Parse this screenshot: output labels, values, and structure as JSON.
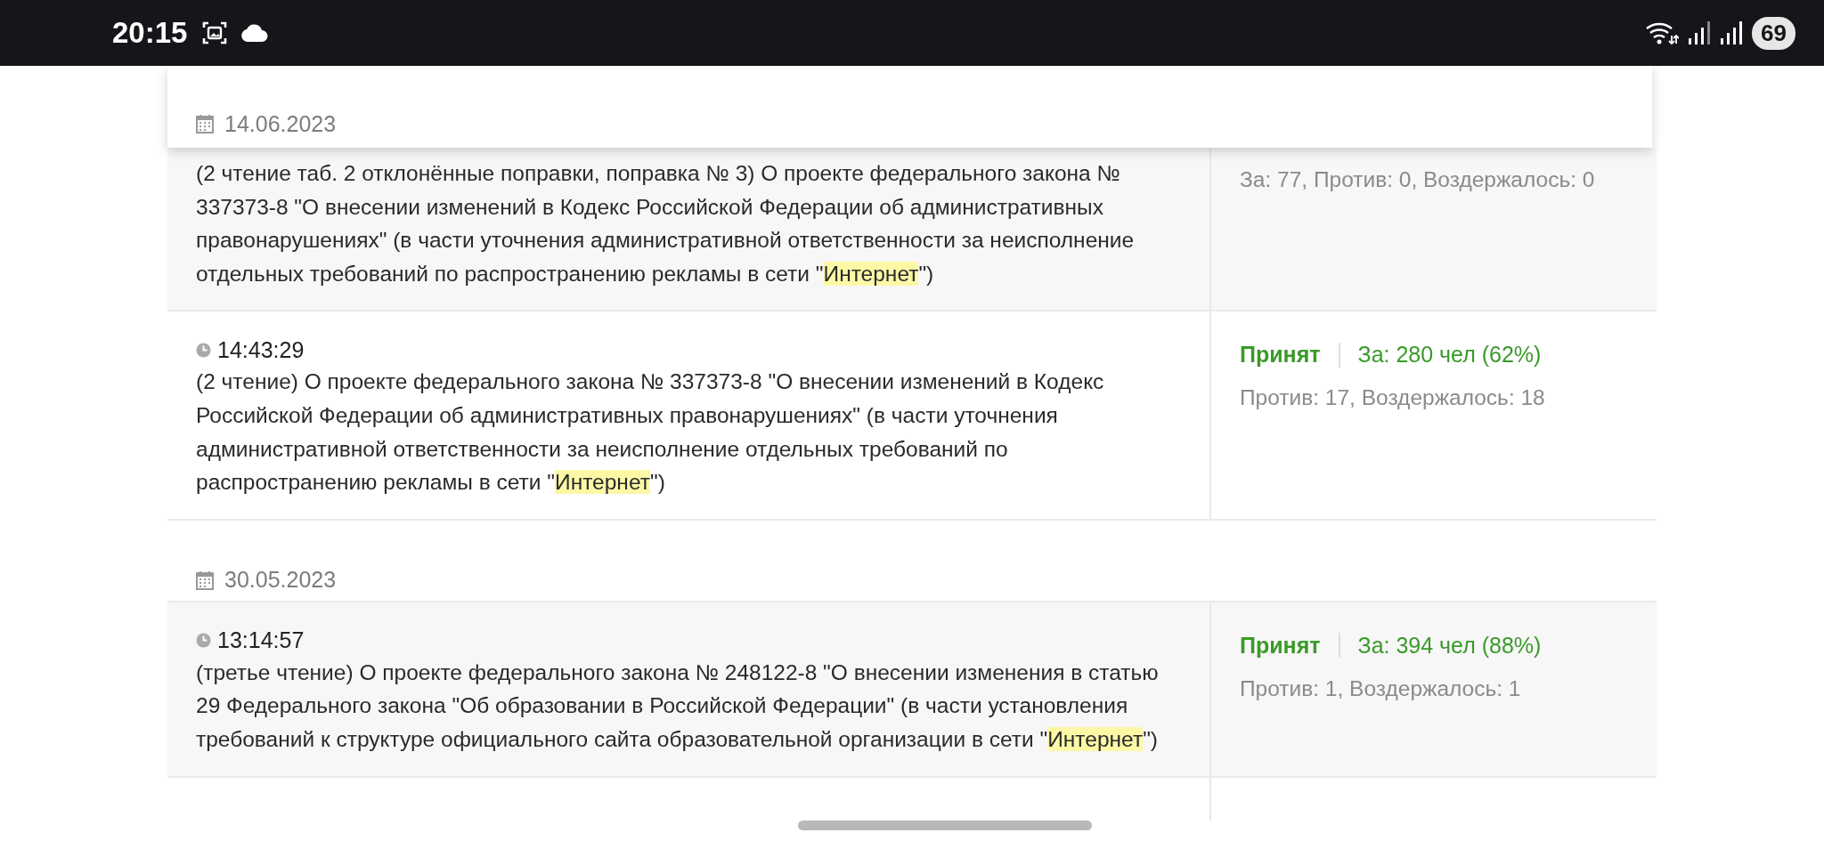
{
  "status_bar": {
    "time": "20:15",
    "battery": "69"
  },
  "sections": [
    {
      "date": "14.06.2023",
      "sticky": true,
      "votes": [
        {
          "description": [
            {
              "text": "(2 чтение таб. 2 отклонённые поправки, поправка № 3) О проекте федерального закона № 337373-8 \"О внесении изменений в Кодекс Российской Федерации об административных правонарушениях\" (в части уточнения административной ответственности за неисполнение отдельных требований по распространению рекламы в сети \"",
              "highlight": false
            },
            {
              "text": "Интернет",
              "highlight": true
            },
            {
              "text": "\")",
              "highlight": false
            }
          ],
          "summary": "За: 77, Против: 0, Воздержалось: 0"
        },
        {
          "time": "14:43:29",
          "description": [
            {
              "text": "(2 чтение) О проекте федерального закона № 337373-8 \"О внесении изменений в Кодекс Российской Федерации об административных правонарушениях\" (в части уточнения административной ответственности за неисполнение отдельных требований по распространению рекламы в сети \"",
              "highlight": false
            },
            {
              "text": "Интернет",
              "highlight": true
            },
            {
              "text": "\")",
              "highlight": false
            }
          ],
          "result": "Принят",
          "for": "За: 280 чел (62%)",
          "summary": "Против: 17, Воздержалось: 18"
        }
      ]
    },
    {
      "date": "30.05.2023",
      "sticky": false,
      "votes": [
        {
          "time": "13:14:57",
          "description": [
            {
              "text": "(третье чтение) О проекте федерального закона № 248122-8 \"О внесении изменения в статью 29 Федерального закона \"Об образовании в Российской Федерации\" (в части установления требований к структуре официального сайта образовательной организации в сети \"",
              "highlight": false
            },
            {
              "text": "Интернет",
              "highlight": true
            },
            {
              "text": "\")",
              "highlight": false
            }
          ],
          "result": "Принят",
          "for": "За: 394 чел (88%)",
          "summary": "Против: 1, Воздержалось: 1"
        }
      ]
    }
  ]
}
